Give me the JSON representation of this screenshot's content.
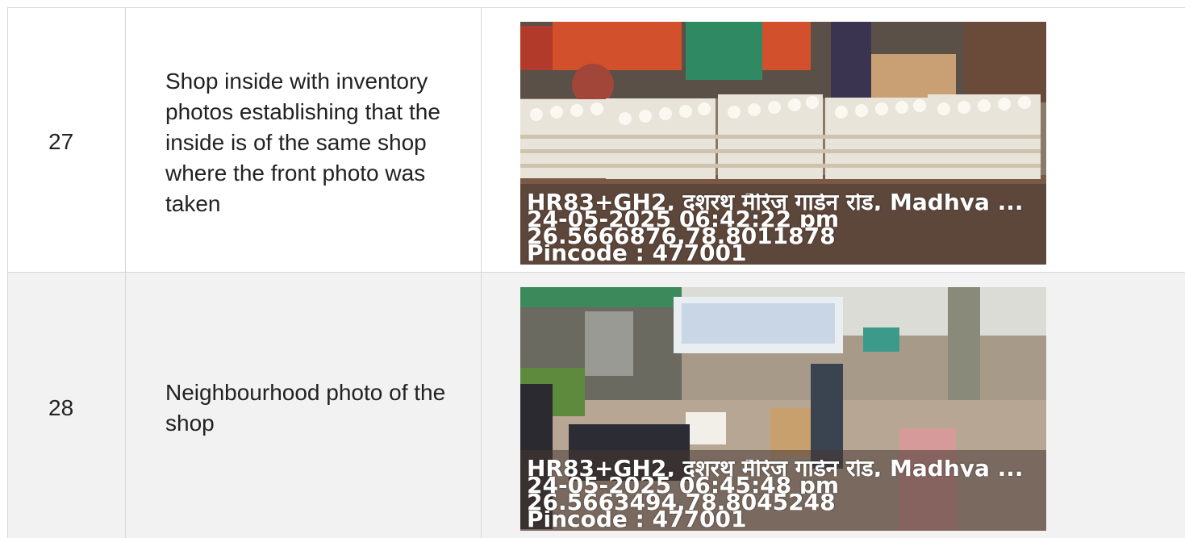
{
  "rows": [
    {
      "number": "27",
      "description": "Shop inside with inventory photos establishing that the inside is of the same shop where the front photo was taken",
      "photo": {
        "location": "HR83+GH2, दशरथ मैरिज गार्डन रोड, Madhya ...",
        "datetime": "24-05-2025 06:42:22 pm",
        "coordinates": "26.5666876,78.8011878",
        "pincode": "Pincode : 477001"
      }
    },
    {
      "number": "28",
      "description": "Neighbourhood photo of the shop",
      "photo": {
        "location": "HR83+GH2, दशरथ मैरिज गार्डन रोड, Madhya ...",
        "datetime": "24-05-2025 06:45:48 pm",
        "coordinates": "26.5663494,78.8045248",
        "pincode": "Pincode : 477001"
      }
    }
  ]
}
